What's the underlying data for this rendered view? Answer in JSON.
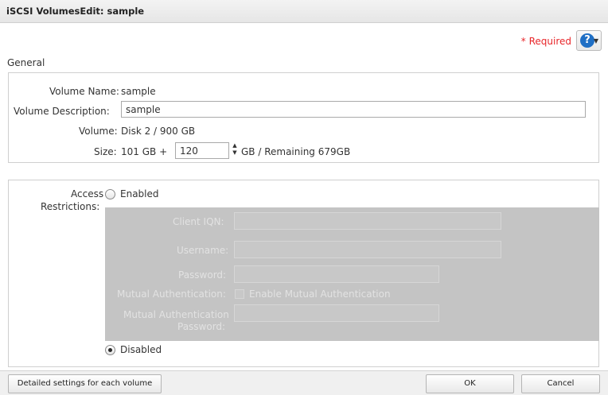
{
  "window": {
    "title": "iSCSI VolumesEdit: sample"
  },
  "header": {
    "required_label": "* Required",
    "help_glyph": "?",
    "help_icon": "question-circle-icon"
  },
  "general": {
    "section_title": "General",
    "volume_name_label": "Volume Name:",
    "volume_name_value": "sample",
    "volume_description_label": "Volume Description:",
    "volume_description_value": "sample",
    "volume_label": "Volume:",
    "volume_value": "Disk 2 / 900 GB",
    "size_label": "Size:",
    "size_prefix": "101 GB +",
    "size_input_value": "120",
    "size_suffix": "GB / Remaining 679GB"
  },
  "access": {
    "label_line1": "Access",
    "label_line2": "Restrictions:",
    "enabled_label": "Enabled",
    "disabled_label": "Disabled",
    "selected": "Disabled",
    "client_iqn_label": "Client IQN:",
    "username_label": "Username:",
    "password_label": "Password:",
    "mutual_auth_label": "Mutual Authentication:",
    "mutual_auth_checkbox_label": "Enable Mutual Authentication",
    "mutual_auth_password_label_line1": "Mutual Authentication",
    "mutual_auth_password_label_line2": "Password:"
  },
  "footer": {
    "detailed_button": "Detailed settings for each volume",
    "ok_button": "OK",
    "cancel_button": "Cancel"
  },
  "colors": {
    "required": "#e8262a",
    "help_accent": "#1f6fc5",
    "disabled_area": "#c4c4c4"
  }
}
